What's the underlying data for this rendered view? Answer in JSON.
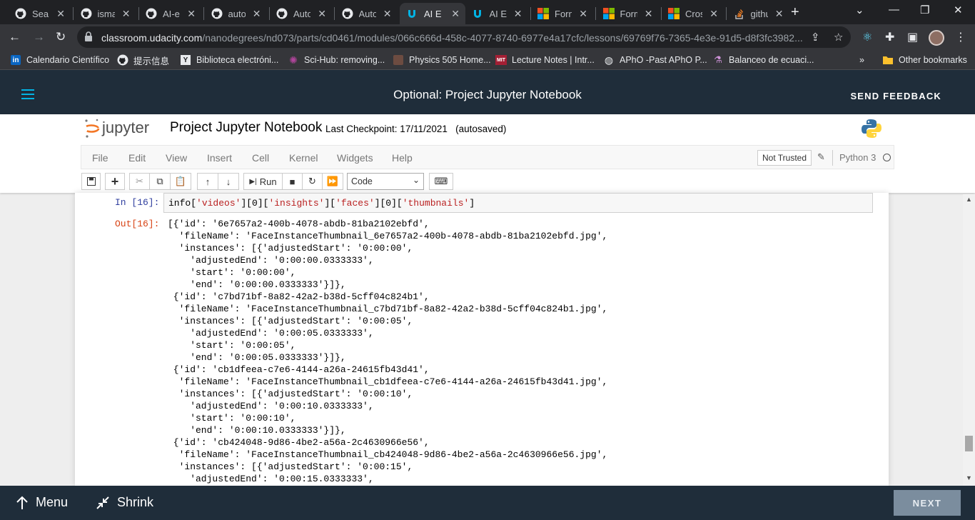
{
  "browser": {
    "tabs": [
      {
        "label": "Search",
        "icon": "github-icon",
        "active": false
      },
      {
        "label": "ismael",
        "icon": "github-icon",
        "active": false
      },
      {
        "label": "AI-en",
        "icon": "github-icon",
        "active": false
      },
      {
        "label": "autom",
        "icon": "github-icon",
        "active": false
      },
      {
        "label": "Auto",
        "icon": "github-icon",
        "active": false
      },
      {
        "label": "Auto",
        "icon": "github-icon",
        "active": false
      },
      {
        "label": "AI En",
        "icon": "udacity-icon",
        "active": true
      },
      {
        "label": "AI En",
        "icon": "udacity-icon",
        "active": false
      },
      {
        "label": "Form",
        "icon": "microsoft-icon",
        "active": false
      },
      {
        "label": "Form",
        "icon": "microsoft-icon",
        "active": false
      },
      {
        "label": "Cross",
        "icon": "microsoft-icon",
        "active": false
      },
      {
        "label": "github",
        "icon": "stackoverflow-icon",
        "active": false
      }
    ],
    "url_host": "classroom.udacity.com",
    "url_path": "/nanodegrees/nd073/parts/cd0461/modules/066c666d-458c-4077-8740-6977e4a17cfc/lessons/69769f76-7365-4e3e-91d5-d8f3fc3982...",
    "bookmarks": [
      {
        "label": "Calendario Científico",
        "icon": "linkedin-icon"
      },
      {
        "label": "提示信息",
        "icon": "github-icon"
      },
      {
        "label": "Biblioteca electróni...",
        "icon": "y-icon"
      },
      {
        "label": "Sci-Hub: removing...",
        "icon": "scihub-icon"
      },
      {
        "label": "Physics 505 Home...",
        "icon": "physics-icon"
      },
      {
        "label": "Lecture Notes | Intr...",
        "icon": "mit-icon"
      },
      {
        "label": "APhO -Past APhO P...",
        "icon": "globe-icon"
      },
      {
        "label": "Balanceo de ecuaci...",
        "icon": "flask-icon"
      }
    ],
    "overflow_label": "»",
    "other_bookmarks": "Other bookmarks"
  },
  "udacity": {
    "title": "Optional: Project Jupyter Notebook",
    "feedback": "SEND FEEDBACK",
    "footer_menu": "Menu",
    "footer_shrink": "Shrink",
    "next": "NEXT"
  },
  "jupyter": {
    "logo_text": "jupyter",
    "notebook_name": "Project Jupyter Notebook",
    "checkpoint": "Last Checkpoint: 17/11/2021   (autosaved)",
    "menu": [
      "File",
      "Edit",
      "View",
      "Insert",
      "Cell",
      "Kernel",
      "Widgets",
      "Help"
    ],
    "trust": "Not Trusted",
    "kernel": "Python 3",
    "run_label": "Run",
    "cell_type": "Code",
    "in_prompt": "In [16]:",
    "out_prompt": "Out[16]:",
    "code": {
      "pre": "info[",
      "k1": "'videos'",
      "m1": "][0][",
      "k2": "'insights'",
      "m2": "][",
      "k3": "'faces'",
      "m3": "][0][",
      "k4": "'thumbnails'",
      "post": "]"
    },
    "output_lines": [
      "[{'id': '6e7657a2-400b-4078-abdb-81ba2102ebfd',",
      "  'fileName': 'FaceInstanceThumbnail_6e7657a2-400b-4078-abdb-81ba2102ebfd.jpg',",
      "  'instances': [{'adjustedStart': '0:00:00',",
      "    'adjustedEnd': '0:00:00.0333333',",
      "    'start': '0:00:00',",
      "    'end': '0:00:00.0333333'}]},",
      " {'id': 'c7bd71bf-8a82-42a2-b38d-5cff04c824b1',",
      "  'fileName': 'FaceInstanceThumbnail_c7bd71bf-8a82-42a2-b38d-5cff04c824b1.jpg',",
      "  'instances': [{'adjustedStart': '0:00:05',",
      "    'adjustedEnd': '0:00:05.0333333',",
      "    'start': '0:00:05',",
      "    'end': '0:00:05.0333333'}]},",
      " {'id': 'cb1dfeea-c7e6-4144-a26a-24615fb43d41',",
      "  'fileName': 'FaceInstanceThumbnail_cb1dfeea-c7e6-4144-a26a-24615fb43d41.jpg',",
      "  'instances': [{'adjustedStart': '0:00:10',",
      "    'adjustedEnd': '0:00:10.0333333',",
      "    'start': '0:00:10',",
      "    'end': '0:00:10.0333333'}]},",
      " {'id': 'cb424048-9d86-4be2-a56a-2c4630966e56',",
      "  'fileName': 'FaceInstanceThumbnail_cb424048-9d86-4be2-a56a-2c4630966e56.jpg',",
      "  'instances': [{'adjustedStart': '0:00:15',",
      "    'adjustedEnd': '0:00:15.0333333',"
    ]
  },
  "colors": {
    "udacity_header": "#1f2d3a",
    "udacity_accent": "#02b3e4",
    "jupyter_orange": "#f37726",
    "code_string": "#ba2121",
    "in_prompt": "#303f9f",
    "out_prompt": "#d84315"
  }
}
